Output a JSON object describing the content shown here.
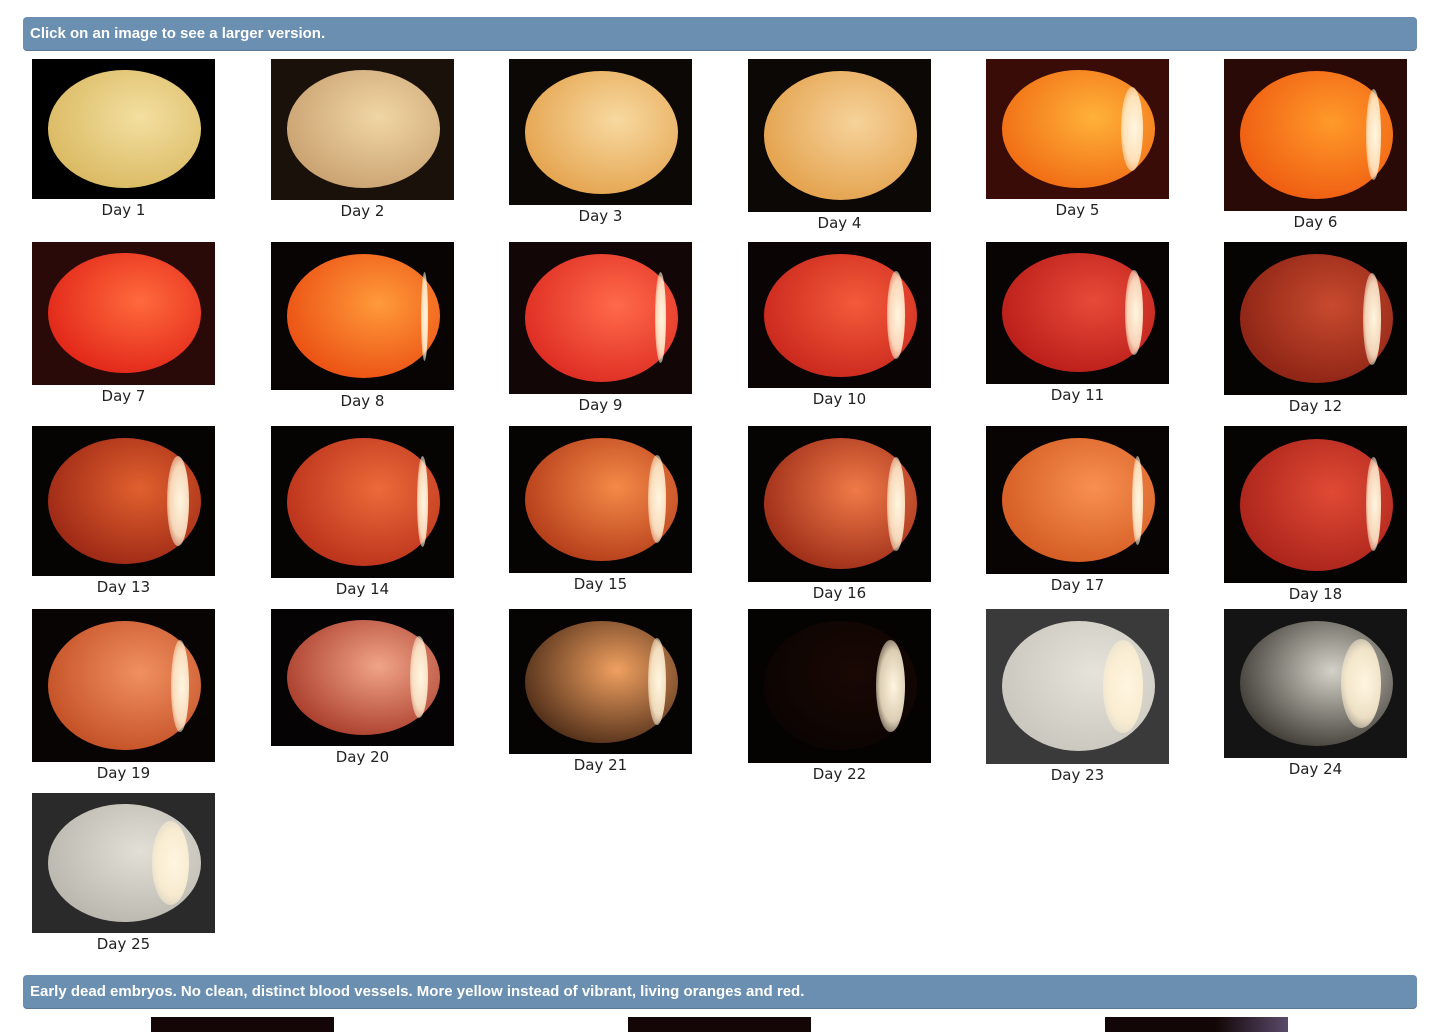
{
  "top_banner": {
    "text": "Click on an image to see a larger version."
  },
  "gallery": {
    "items": [
      {
        "label": "Day 1",
        "colors": [
          "#f3dfa0",
          "#d9b860",
          "#000000"
        ],
        "light": 0.0
      },
      {
        "label": "Day 2",
        "colors": [
          "#f0d6a4",
          "#c9a070",
          "#1a120a"
        ],
        "light": 0.0
      },
      {
        "label": "Day 3",
        "colors": [
          "#f7d9a0",
          "#e4a24c",
          "#0c0806"
        ],
        "light": 0.0
      },
      {
        "label": "Day 4",
        "colors": [
          "#f6d29a",
          "#e3a04a",
          "#0c0806"
        ],
        "light": 0.0
      },
      {
        "label": "Day 5",
        "colors": [
          "#ffb23a",
          "#f06a12",
          "#3a0c08"
        ],
        "light": 0.12
      },
      {
        "label": "Day 6",
        "colors": [
          "#ff9a2a",
          "#ee5a10",
          "#2a0a06"
        ],
        "light": 0.08
      },
      {
        "label": "Day 7",
        "colors": [
          "#ff6a3c",
          "#e02418",
          "#2a0a08"
        ],
        "light": 0.0
      },
      {
        "label": "Day 8",
        "colors": [
          "#ff9a3a",
          "#ea4e12",
          "#080404"
        ],
        "light": 0.04
      },
      {
        "label": "Day 9",
        "colors": [
          "#ff6a4a",
          "#dc2a22",
          "#120606"
        ],
        "light": 0.06
      },
      {
        "label": "Day 10",
        "colors": [
          "#f45a3a",
          "#c8261c",
          "#0a0404"
        ],
        "light": 0.1
      },
      {
        "label": "Day 11",
        "colors": [
          "#e84a38",
          "#b81c18",
          "#080404"
        ],
        "light": 0.1
      },
      {
        "label": "Day 12",
        "colors": [
          "#c84a2e",
          "#8a2214",
          "#060303"
        ],
        "light": 0.1
      },
      {
        "label": "Day 13",
        "colors": [
          "#e0602e",
          "#9a2614",
          "#060303"
        ],
        "light": 0.12
      },
      {
        "label": "Day 14",
        "colors": [
          "#ec6a3a",
          "#b8301a",
          "#060303"
        ],
        "light": 0.06
      },
      {
        "label": "Day 15",
        "colors": [
          "#f48a48",
          "#b23a18",
          "#060303"
        ],
        "light": 0.1
      },
      {
        "label": "Day 16",
        "colors": [
          "#f07a48",
          "#9a2a16",
          "#060303"
        ],
        "light": 0.1
      },
      {
        "label": "Day 17",
        "colors": [
          "#f89050",
          "#d25a22",
          "#080404"
        ],
        "light": 0.06
      },
      {
        "label": "Day 18",
        "colors": [
          "#e04a34",
          "#a8221a",
          "#060303"
        ],
        "light": 0.08
      },
      {
        "label": "Day 19",
        "colors": [
          "#f09060",
          "#c24e24",
          "#080404"
        ],
        "light": 0.1
      },
      {
        "label": "Day 20",
        "colors": [
          "#f0a488",
          "#a83a2a",
          "#050303"
        ],
        "light": 0.1
      },
      {
        "label": "Day 21",
        "colors": [
          "#f0a060",
          "#4a2a16",
          "#060303"
        ],
        "light": 0.1
      },
      {
        "label": "Day 22",
        "colors": [
          "#1a0804",
          "#0a0402",
          "#050202"
        ],
        "light": 0.16
      },
      {
        "label": "Day 23",
        "colors": [
          "#e6e4da",
          "#c8c6bc",
          "#3a3a3a"
        ],
        "light": 0.22
      },
      {
        "label": "Day 24",
        "colors": [
          "#d4d2c8",
          "#3a3630",
          "#141414"
        ],
        "light": 0.22
      },
      {
        "label": "Day 25",
        "colors": [
          "#e2e0d6",
          "#b8b6ac",
          "#2a2a2a"
        ],
        "light": 0.2
      }
    ]
  },
  "bottom_banner": {
    "text": "Early dead embryos. No clean, distinct blood vessels. More yellow instead of vibrant, living oranges and red."
  }
}
